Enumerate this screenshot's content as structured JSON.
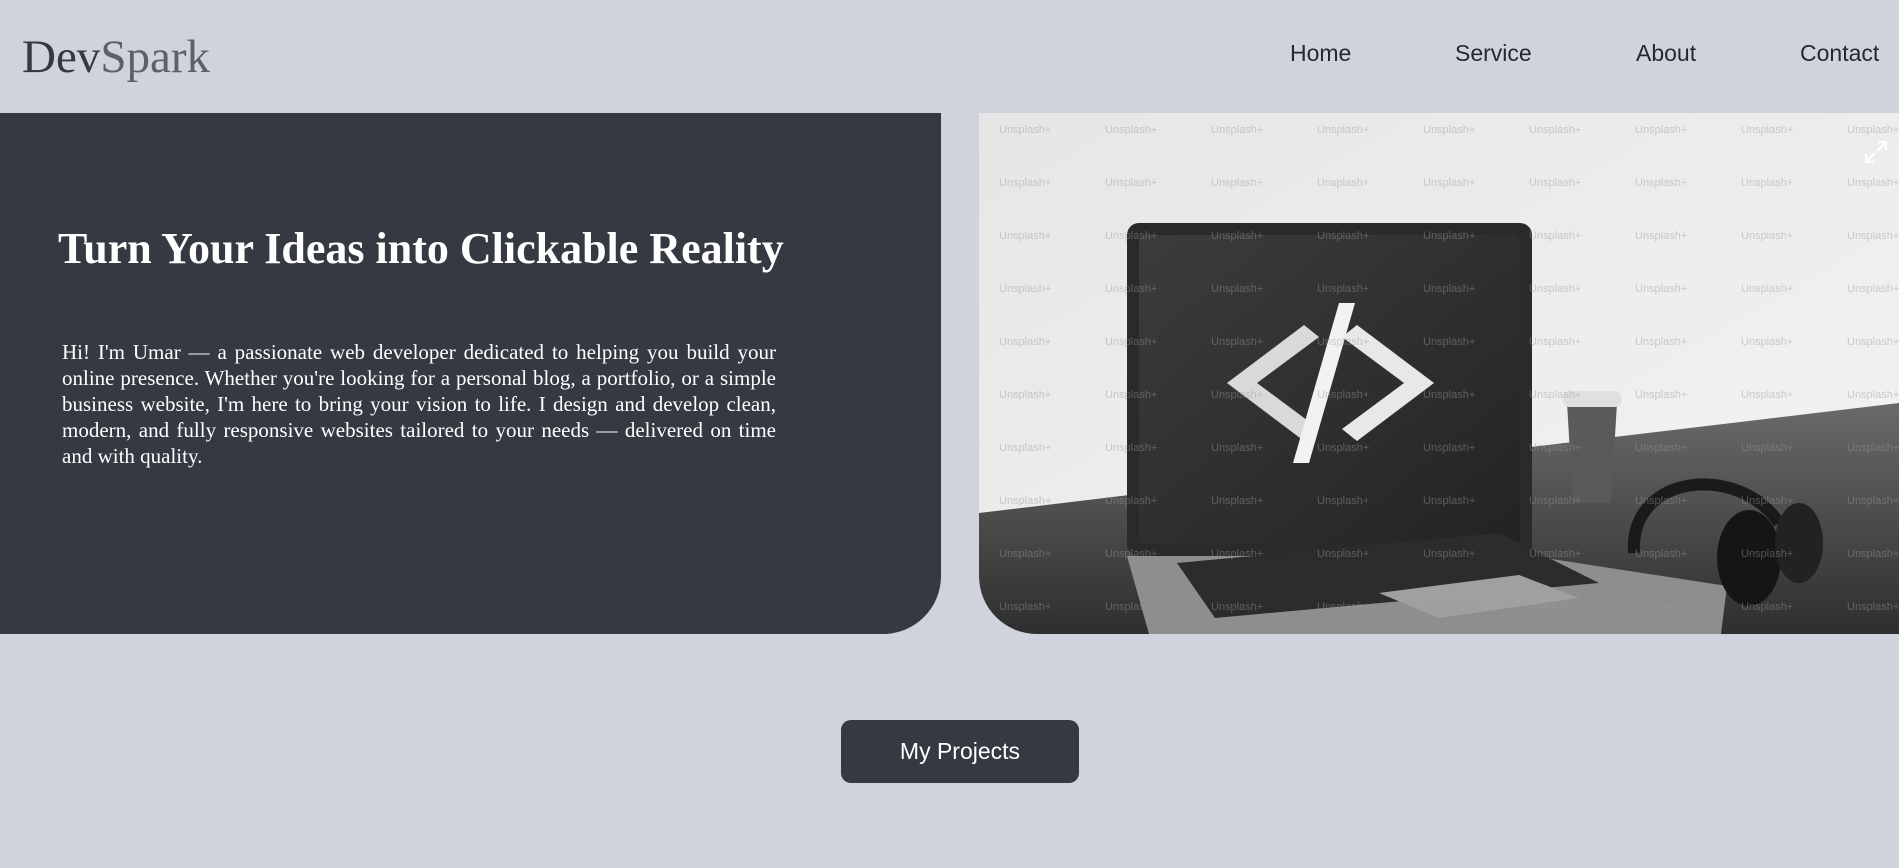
{
  "brand": {
    "part1": "Dev",
    "part2": "Spark"
  },
  "nav": {
    "items": [
      {
        "label": "Home"
      },
      {
        "label": "Service"
      },
      {
        "label": "About"
      },
      {
        "label": "Contact"
      }
    ]
  },
  "hero": {
    "title": "Turn Your Ideas into Clickable Reality",
    "text": "Hi! I'm Umar — a passionate web developer dedicated to helping you build your online presence. Whether you're looking for a personal blog, a portfolio, or a simple business website, I'm here to bring your vision to life. I design and develop clean, modern, and fully responsive websites tailored to your needs — delivered on time and with quality.",
    "image_watermark": "Unsplash+",
    "image_icon": "expand-icon"
  },
  "cta": {
    "label": "My Projects"
  },
  "colors": {
    "page_bg": "#cfd4dc",
    "panel_bg": "#343942",
    "text_light": "#ffffff",
    "text_dark": "#25292f"
  }
}
